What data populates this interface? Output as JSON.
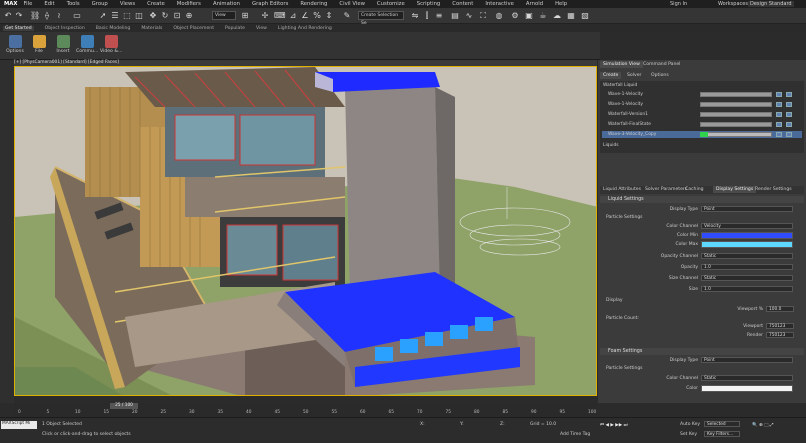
{
  "menu": {
    "logo": "MAX",
    "items": [
      "File",
      "Edit",
      "Tools",
      "Group",
      "Views",
      "Create",
      "Modifiers",
      "Animation",
      "Graph Editors",
      "Rendering",
      "Civil View",
      "Customize",
      "Scripting",
      "Content",
      "Interactive",
      "Arnold",
      "Help"
    ],
    "sign_in": "Sign In",
    "workspaces_label": "Workspaces:",
    "workspace": "Design Standard"
  },
  "toolbar": {
    "view_dropdown": "View",
    "selection_set": "Create Selection Se"
  },
  "ribbon_tabs": [
    "Get Started",
    "Object Inspection",
    "Basic Modeling",
    "Materials",
    "Object Placement",
    "Populate",
    "View",
    "Lighting And Rendering"
  ],
  "ribbon_buttons": [
    "Options",
    "File",
    "Insert",
    "Commu...",
    "Video &..."
  ],
  "viewport": {
    "label": "[+] [PhysCamera001] [Standard] [Edged Faces]"
  },
  "panel": {
    "tabs_top": [
      "Simulation View",
      "Command Panel"
    ],
    "tabs_sub": [
      "Create",
      "Solver",
      "Options"
    ],
    "tree_root": "Waterfall Liquid",
    "tree_items": [
      "Wave-1-Velocity",
      "Wave-1-Velocity",
      "Waterfall-Version1",
      "Waterfall-FinalState",
      "Wave-3-Velocity_Copy"
    ],
    "tree_footer": "Liquids",
    "attr_tabs": [
      "Liquid Attributes",
      "Solver Parameters",
      "Caching",
      "Display Settings",
      "Render Settings"
    ],
    "liquid_settings": "Liquid Settings",
    "display_type_label": "Display Type",
    "display_type": "Point",
    "particle_settings": "Particle Settings",
    "color_channel_label": "Color Channel",
    "color_channel": "Velocity",
    "color_min_label": "Color Min",
    "color_min": "#2f4cff",
    "color_max_label": "Color Max",
    "color_max": "#5fd8ff",
    "opacity_channel_label": "Opacity Channel",
    "opacity_channel": "Static",
    "opacity_label": "Opacity",
    "opacity": "1.0",
    "size_channel_label": "Size Channel",
    "size_channel": "Static",
    "size_label": "Size",
    "size": "1.0",
    "display_label": "Display",
    "viewport_pct_label": "Viewport %",
    "viewport_pct": "100.0",
    "particle_count_label": "Particle Count:",
    "pc_viewport_label": "Viewport",
    "pc_viewport": "750123",
    "pc_render_label": "Render",
    "pc_render": "750123",
    "foam_settings": "Foam Settings",
    "foam_display_type": "Point",
    "foam_particle_settings": "Particle Settings",
    "foam_color_channel": "Static",
    "foam_color_label": "Color"
  },
  "timeline": {
    "frame": "25 / 100",
    "ticks": [
      "0",
      "5",
      "10",
      "15",
      "20",
      "25",
      "30",
      "35",
      "40",
      "45",
      "50",
      "55",
      "60",
      "65",
      "70",
      "75",
      "80",
      "85",
      "90",
      "95",
      "100"
    ]
  },
  "status": {
    "listener": "MAXScript Mi",
    "selected": "1 Object Selected",
    "hint": "Click or click-and-drag to select objects",
    "x_label": "X:",
    "y_label": "Y:",
    "z_label": "Z:",
    "grid": "Grid = 10.0",
    "add_time_tag": "Add Time Tag",
    "auto_key": "Auto Key",
    "selected_dd": "Selected",
    "set_key": "Set Key",
    "key_filters": "Key Filters..."
  },
  "right_ruler": [
    "30",
    "40",
    "50",
    "60",
    "70",
    "80",
    "90",
    "100"
  ]
}
